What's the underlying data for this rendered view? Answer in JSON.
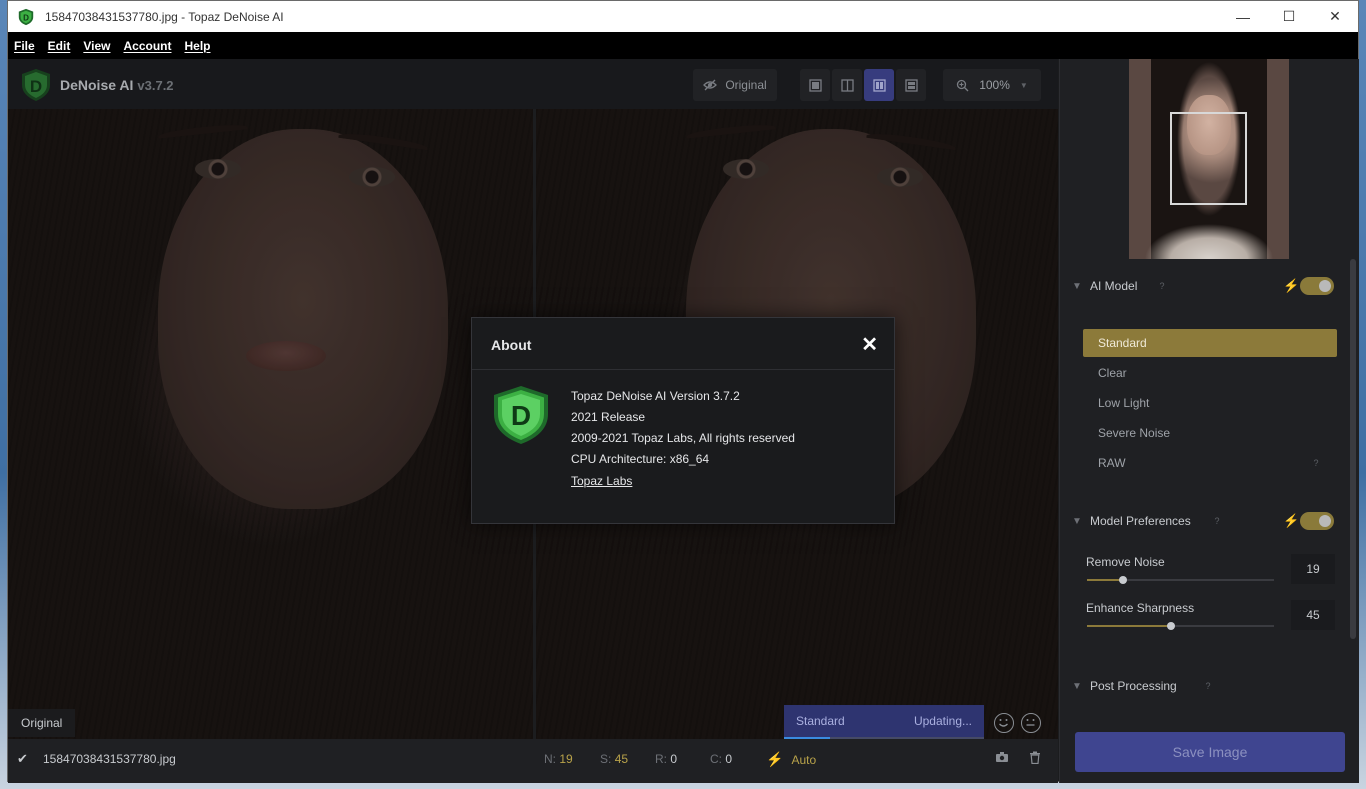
{
  "window": {
    "title": "15847038431537780.jpg - Topaz DeNoise AI",
    "minimize": "—",
    "maximize": "☐",
    "close": "✕"
  },
  "menu": {
    "file": "File",
    "edit": "Edit",
    "view": "View",
    "account": "Account",
    "help": "Help"
  },
  "brand": {
    "name": "DeNoise AI",
    "version": "v3.7.2",
    "logo_letter": "D"
  },
  "toolbar": {
    "original_label": "Original",
    "zoom_label": "100%"
  },
  "image": {
    "original_label": "Original"
  },
  "progress": {
    "model": "Standard",
    "status": "Updating...",
    "fraction": 0.23
  },
  "status": {
    "filename": "15847038431537780.jpg",
    "n_label": "N:",
    "n_value": "19",
    "s_label": "S:",
    "s_value": "45",
    "r_label": "R:",
    "r_value": "0",
    "c_label": "C:",
    "c_value": "0",
    "auto_label": "Auto"
  },
  "panel": {
    "ai_model": {
      "label": "AI Model",
      "enabled": true,
      "options": [
        "Standard",
        "Clear",
        "Low Light",
        "Severe Noise",
        "RAW"
      ],
      "selected": "Standard"
    },
    "model_preferences": {
      "label": "Model Preferences",
      "enabled": true,
      "remove_noise_label": "Remove Noise",
      "remove_noise_value": 19,
      "enhance_sharpness_label": "Enhance Sharpness",
      "enhance_sharpness_value": 45
    },
    "post_processing": {
      "label": "Post Processing"
    },
    "save_label": "Save Image",
    "help_glyph": "?"
  },
  "about": {
    "title": "About",
    "line1": "Topaz DeNoise AI Version 3.7.2",
    "line2": "2021 Release",
    "line3": "2009-2021 Topaz Labs, All rights reserved",
    "line4": "CPU Architecture: x86_64",
    "link": "Topaz Labs"
  },
  "colors": {
    "accent_gold": "#8c7a3a",
    "accent_blue": "#3f4590",
    "logo_green": "#3cb043"
  }
}
